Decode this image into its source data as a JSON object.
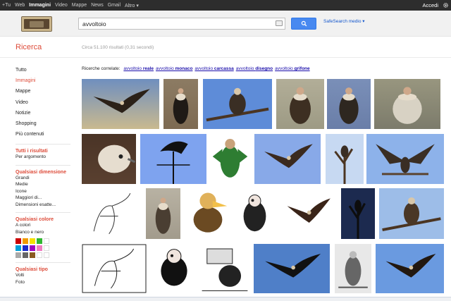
{
  "topbar": {
    "links": [
      "+Tu",
      "Web",
      "Immagini",
      "Video",
      "Mappe",
      "News",
      "Gmail",
      "Altro ▾"
    ],
    "active": "Immagini",
    "signin": "Accedi"
  },
  "search": {
    "query": "avvoltoio",
    "safesearch": "SafeSearch medio ▾"
  },
  "results": {
    "heading": "Ricerca",
    "count": "Circa 51.100 risultati (0,31 secondi)"
  },
  "sidebar": {
    "nav": [
      "Tutto",
      "Immagini",
      "Mappe",
      "Video",
      "Notizie",
      "Shopping",
      "Più contenuti"
    ],
    "active_index": 1,
    "filters": {
      "results_title": "Tutti i risultati",
      "results_opts": [
        "Per argomento"
      ],
      "size_title": "Qualsiasi dimensione",
      "size_opts": [
        "Grandi",
        "Medie",
        "Icone",
        "Maggiori di...",
        "Dimensioni esatte..."
      ],
      "color_title": "Qualsiasi colore",
      "color_opts": [
        "A colori",
        "Bianco e nero"
      ],
      "swatches": [
        "#cc0000",
        "#f09a00",
        "#f5e000",
        "#2fb62f",
        "#ffffff",
        "#00a0d8",
        "#1a2bcc",
        "#a000c0",
        "#f07cc0",
        "#ffffff",
        "#aaaaaa",
        "#666666",
        "#8a5a20",
        "#ffffff",
        "#ffffff"
      ],
      "type_title": "Qualsiasi tipo",
      "type_opts": [
        "Volti",
        "Foto"
      ]
    }
  },
  "related": {
    "label": "Ricerche correlate:",
    "items": [
      {
        "prefix": "avvoltoio",
        "bold": "reale"
      },
      {
        "prefix": "avvoltoio",
        "bold": "monaco"
      },
      {
        "prefix": "avvoltoio",
        "bold": "carcassa"
      },
      {
        "prefix": "avvoltoio",
        "bold": "disegno"
      },
      {
        "prefix": "avvoltoio",
        "bold": "grifone"
      }
    ]
  },
  "thumbs": [
    {
      "bg": "#c9b98f",
      "fg": "#2b2118",
      "kind": "flight-photo",
      "sky": "#6f8fbf"
    },
    {
      "bg": "#7d6a52",
      "fg": "#1f1a16",
      "kind": "perched",
      "sky": "#8c7b63"
    },
    {
      "bg": "#5e8cd8",
      "fg": "#3a2e24",
      "kind": "branch",
      "sky": "#5e8cd8"
    },
    {
      "bg": "#9d9a84",
      "fg": "#3d2f22",
      "kind": "perched",
      "sky": "#b2ae98"
    },
    {
      "bg": "#6a7ea8",
      "fg": "#2e2720",
      "kind": "perched",
      "sky": "#7a8fb8"
    },
    {
      "bg": "#7c7b6b",
      "fg": "#d8d2c4",
      "kind": "perched",
      "sky": "#98967f"
    },
    {
      "bg": "#5a4030",
      "fg": "#e6ddcf",
      "kind": "closeup",
      "sky": "#4a3426"
    },
    {
      "bg": "#7ea3ef",
      "fg": "#111111",
      "kind": "weathervane",
      "sky": "#7ea3ef"
    },
    {
      "bg": "#ffffff",
      "fg": "#2e7d32",
      "kind": "cartoon-green",
      "sky": "#ffffff"
    },
    {
      "bg": "#88a9e8",
      "fg": "#3b2a1f",
      "kind": "flight-blue",
      "sky": "#88a9e8"
    },
    {
      "bg": "#c7d9f2",
      "fg": "#3a2e24",
      "kind": "treebird",
      "sky": "#c7d9f2"
    },
    {
      "bg": "#8db2ea",
      "fg": "#3a2e24",
      "kind": "wings-open",
      "sky": "#8db2ea"
    },
    {
      "bg": "#ffffff",
      "fg": "#333333",
      "kind": "sketch",
      "sky": "#ffffff"
    },
    {
      "bg": "#a29b8c",
      "fg": "#4a3e32",
      "kind": "perched",
      "sky": "#b8b2a3"
    },
    {
      "bg": "#ffffff",
      "fg": "#6b4a22",
      "kind": "cartoon-brown",
      "sky": "#ffffff"
    },
    {
      "bg": "#ffffff",
      "fg": "#222222",
      "kind": "cartoon-black",
      "sky": "#ffffff"
    },
    {
      "bg": "#ffffff",
      "fg": "#3a2418",
      "kind": "flight-white",
      "sky": "#ffffff"
    },
    {
      "bg": "#1c2a4f",
      "fg": "#0d0d0d",
      "kind": "tree-night",
      "sky": "#1c2a4f"
    },
    {
      "bg": "#9dbde8",
      "fg": "#4a3726",
      "kind": "branch-many",
      "sky": "#9dbde8"
    },
    {
      "bg": "#ffffff",
      "fg": "#222222",
      "kind": "sketch-box",
      "sky": "#ffffff"
    },
    {
      "bg": "#ffffff",
      "fg": "#111111",
      "kind": "cartoon-bw",
      "sky": "#ffffff"
    },
    {
      "bg": "#ffffff",
      "fg": "#222222",
      "kind": "cartoon-sign",
      "sky": "#ffffff"
    },
    {
      "bg": "#4f7fc8",
      "fg": "#111111",
      "kind": "flight-blue",
      "sky": "#4f7fc8"
    },
    {
      "bg": "#e8e8e8",
      "fg": "#333333",
      "kind": "bw-perched",
      "sky": "#e8e8e8"
    },
    {
      "bg": "#6a9ae0",
      "fg": "#221810",
      "kind": "flight-blue",
      "sky": "#6a9ae0"
    }
  ]
}
